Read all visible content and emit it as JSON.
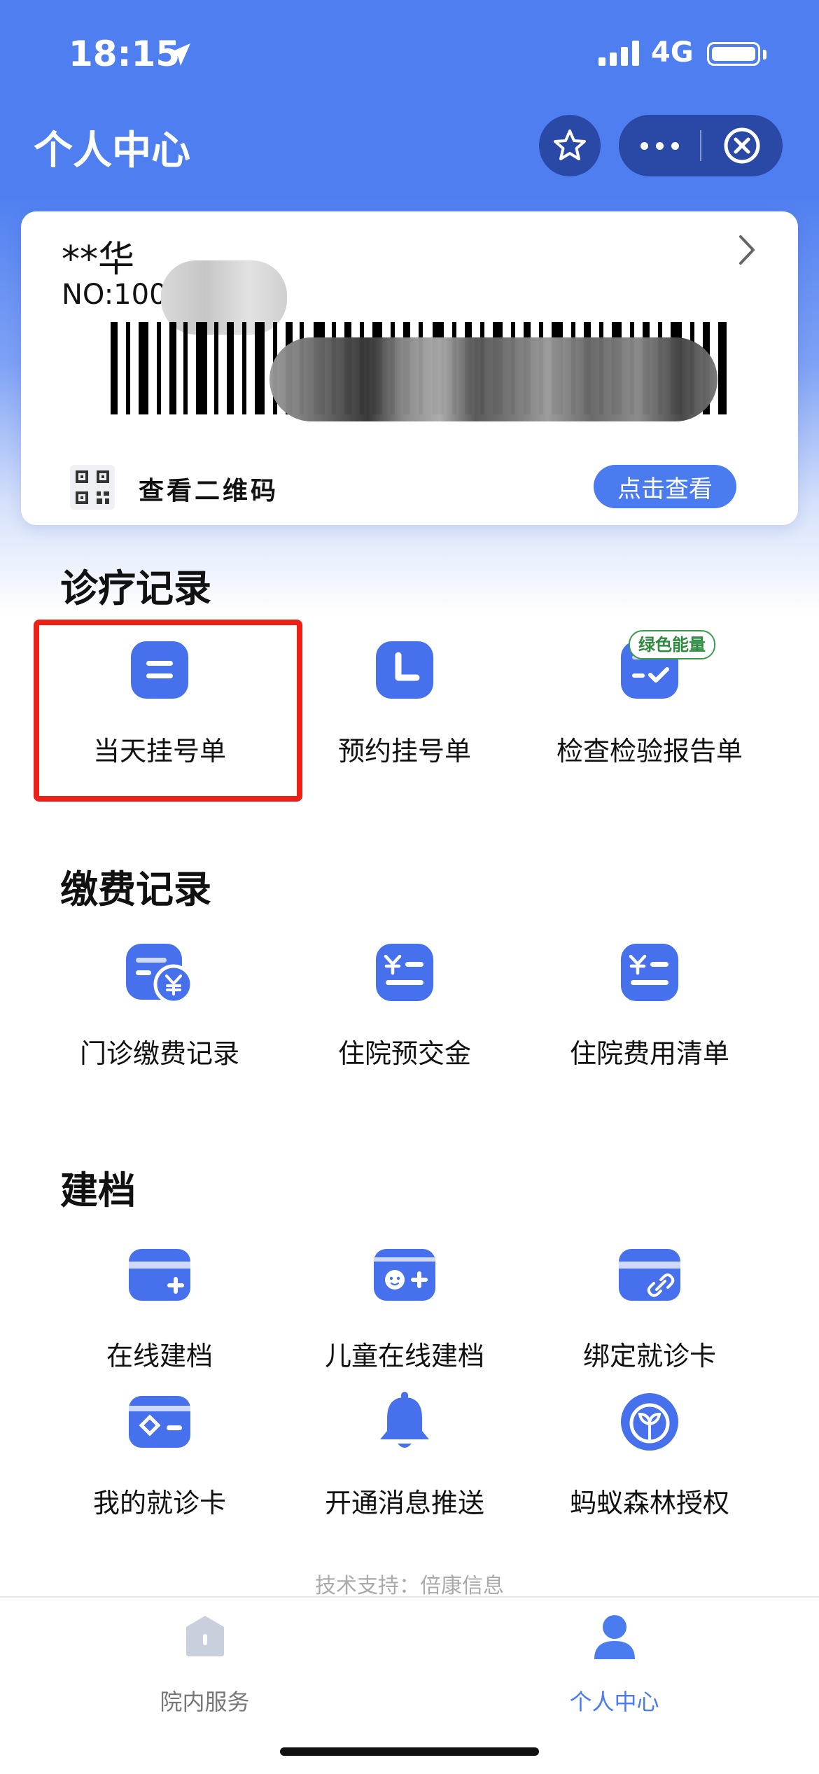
{
  "status_bar": {
    "time": "18:15",
    "network": "4G"
  },
  "header": {
    "title": "个人中心"
  },
  "card": {
    "name": "**华",
    "number_prefix": "NO:100",
    "qr_label": "查看二维码",
    "view_button": "点击查看"
  },
  "sections": {
    "records": {
      "title": "诊疗记录",
      "items": [
        {
          "label": "当天挂号单",
          "icon": "note-list-icon"
        },
        {
          "label": "预约挂号单",
          "icon": "clock-icon"
        },
        {
          "label": "检查检验报告单",
          "icon": "report-check-icon"
        }
      ],
      "badge": "绿色能量"
    },
    "payments": {
      "title": "缴费记录",
      "items": [
        {
          "label": "门诊缴费记录",
          "icon": "payment-yen-icon"
        },
        {
          "label": "住院预交金",
          "icon": "yen-list-icon"
        },
        {
          "label": "住院费用清单",
          "icon": "yen-list-icon"
        }
      ]
    },
    "archive": {
      "title": "建档",
      "items": [
        {
          "label": "在线建档",
          "icon": "card-add-icon"
        },
        {
          "label": "儿童在线建档",
          "icon": "child-card-icon"
        },
        {
          "label": "绑定就诊卡",
          "icon": "card-link-icon"
        },
        {
          "label": "我的就诊卡",
          "icon": "medical-card-icon"
        },
        {
          "label": "开通消息推送",
          "icon": "bell-icon"
        },
        {
          "label": "蚂蚁森林授权",
          "icon": "forest-sprout-icon"
        }
      ]
    }
  },
  "footer": {
    "tech_support": "技术支持：倍康信息"
  },
  "tabbar": {
    "tabs": [
      {
        "label": "院内服务",
        "active": false,
        "icon": "home-service-icon"
      },
      {
        "label": "个人中心",
        "active": true,
        "icon": "person-icon"
      }
    ]
  },
  "colors": {
    "primary": "#4e7ef0",
    "highlight_frame": "#ee1f14",
    "tab_inactive": "#777777",
    "tab_active": "#4a7cf0"
  }
}
